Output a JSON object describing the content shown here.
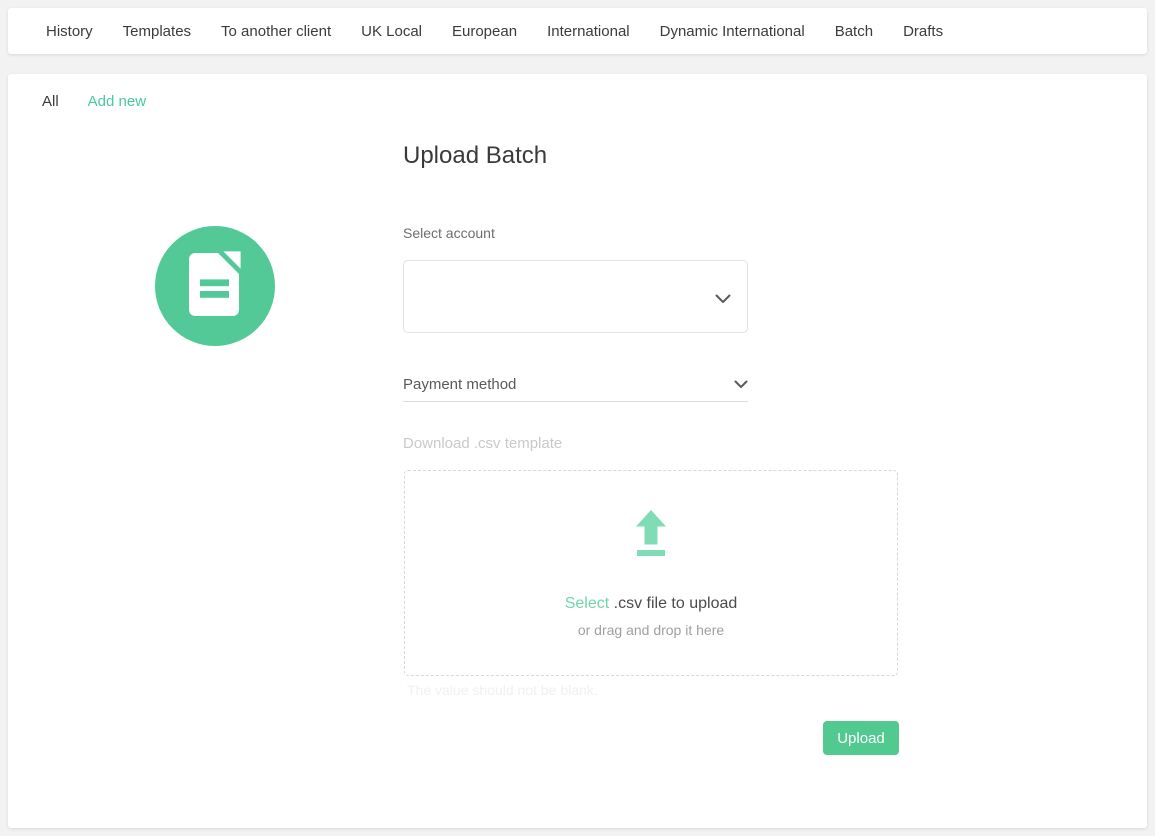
{
  "colors": {
    "accent_green": "#52c997",
    "button_green": "#52c98f",
    "light_green_icon": "#7fdcb7",
    "link_green": "#47c9a2",
    "page_background": "#f2f2f2",
    "nav_text": "#3b3b3b"
  },
  "topnav": {
    "items": [
      "History",
      "Templates",
      "To another client",
      "UK Local",
      "European",
      "International",
      "Dynamic International",
      "Batch",
      "Drafts"
    ]
  },
  "subnav": {
    "all": "All",
    "add_new": "Add new"
  },
  "upload_form": {
    "title": "Upload Batch",
    "account_label": "Select account",
    "account_value": "",
    "payment_method_value": "Payment method",
    "download_template_label": "Download .csv template",
    "dropzone": {
      "select_link": "Select",
      "select_rest": " .csv file to upload",
      "drag_hint": "or drag and drop it here"
    },
    "validation_message": "The value should not be blank.",
    "upload_button_label": "Upload"
  },
  "icons": {
    "document_icon": "white document with folded corner and two green text lines",
    "upload_arrow_icon": "green arrow pointing up above a bar",
    "chevron_down_icon": "grey downward chevron"
  }
}
